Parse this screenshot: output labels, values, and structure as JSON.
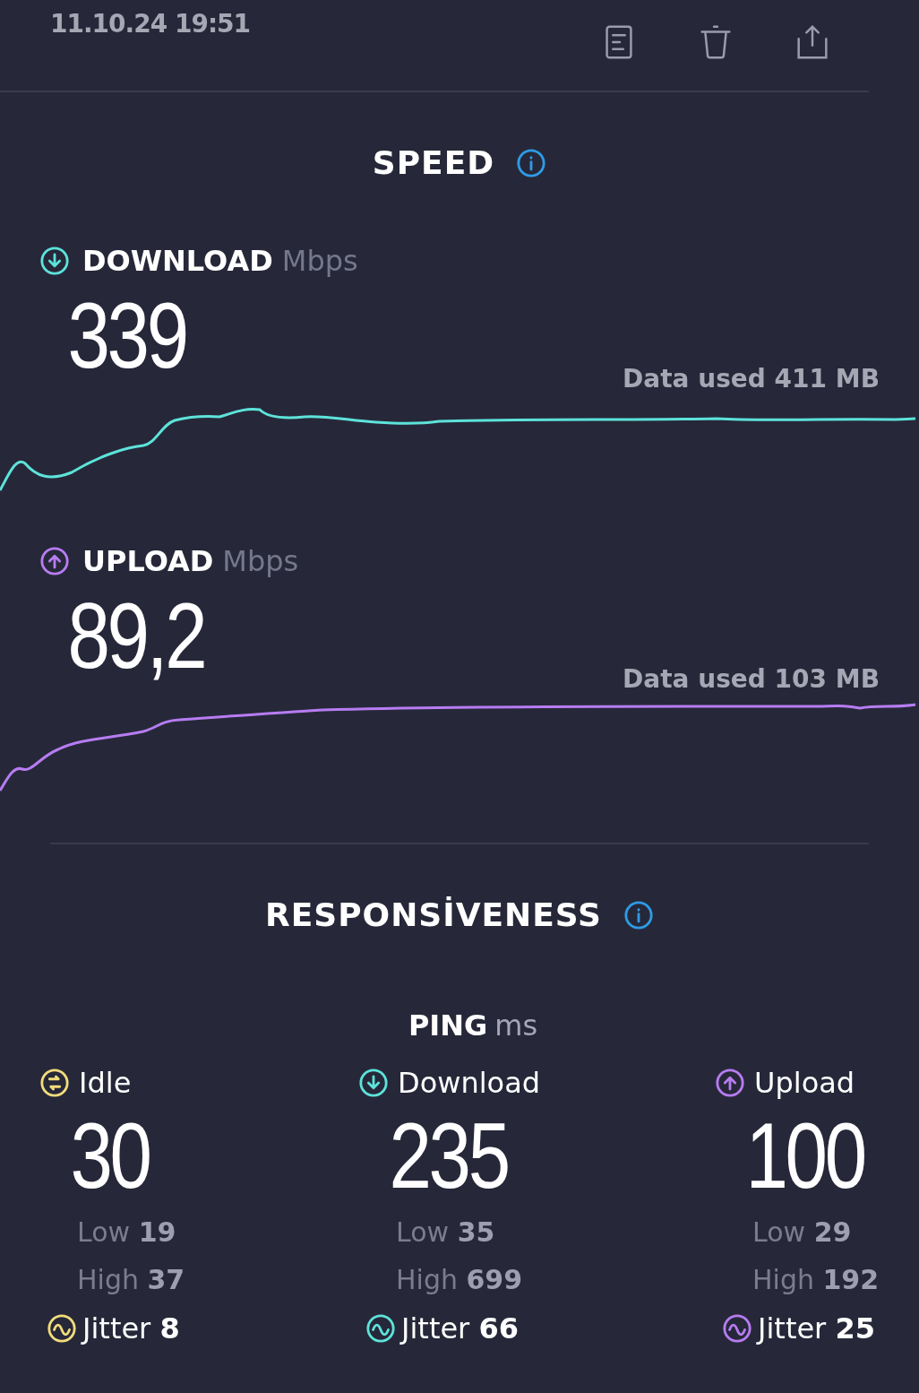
{
  "header": {
    "timestamp": "11.10.24 19:51"
  },
  "speed": {
    "title": "SPEED",
    "tests": [
      {
        "kind": "download",
        "label": "DOWNLOAD",
        "unit": "Mbps",
        "value": "339",
        "data_used": "Data used 411 MB",
        "color": "#5de3da"
      },
      {
        "kind": "upload",
        "label": "UPLOAD",
        "unit": "Mbps",
        "value": "89,2",
        "data_used": "Data used 103 MB",
        "color": "#b77cf2"
      }
    ]
  },
  "responsiveness": {
    "title": "RESPONSİVENESS",
    "ping_label": "PING",
    "ping_unit": "ms",
    "columns": [
      {
        "kind": "idle",
        "label": "Idle",
        "value": "30",
        "low": "Low **19**",
        "high": "High **37**",
        "jitter": "Jitter **8**",
        "color": "#f2dc7c"
      },
      {
        "kind": "download",
        "label": "Download",
        "value": "235",
        "low": "Low **35**",
        "high": "High **699**",
        "jitter": "Jitter **66**",
        "color": "#5de3da"
      },
      {
        "kind": "upload",
        "label": "Upload",
        "value": "100",
        "low": "Low **29**",
        "high": "High **192**",
        "jitter": "Jitter **25**",
        "color": "#b77cf2"
      }
    ]
  }
}
